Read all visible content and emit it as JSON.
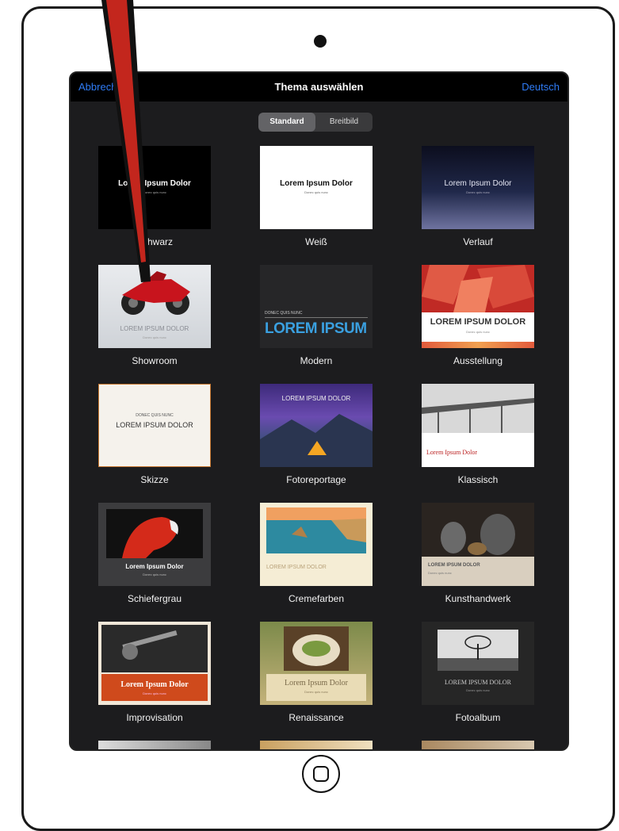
{
  "nav": {
    "cancel_label": "Abbrech",
    "title": "Thema auswählen",
    "language_label": "Deutsch"
  },
  "segments": {
    "standard": "Standard",
    "widescreen": "Breitbild"
  },
  "sample": {
    "lorem_title": "Lorem Ipsum Dolor",
    "lorem_title_caps": "LOREM IPSUM DOLOR",
    "lorem_sub": "Donec quis nunc",
    "lorem_short": "LOREM IPSUM",
    "donec_caps": "DONEC QUIS NUNC"
  },
  "themes": [
    {
      "label": "Schwarz"
    },
    {
      "label": "Weiß"
    },
    {
      "label": "Verlauf"
    },
    {
      "label": "Showroom"
    },
    {
      "label": "Modern"
    },
    {
      "label": "Ausstellung"
    },
    {
      "label": "Skizze"
    },
    {
      "label": "Fotoreportage"
    },
    {
      "label": "Klassisch"
    },
    {
      "label": "Schiefergrau"
    },
    {
      "label": "Cremefarben"
    },
    {
      "label": "Kunsthandwerk"
    },
    {
      "label": "Improvisation"
    },
    {
      "label": "Renaissance"
    },
    {
      "label": "Fotoalbum"
    }
  ],
  "colors": {
    "accent": "#2f7cf6",
    "background": "#1c1c1e",
    "marker_red": "#c3261d"
  }
}
